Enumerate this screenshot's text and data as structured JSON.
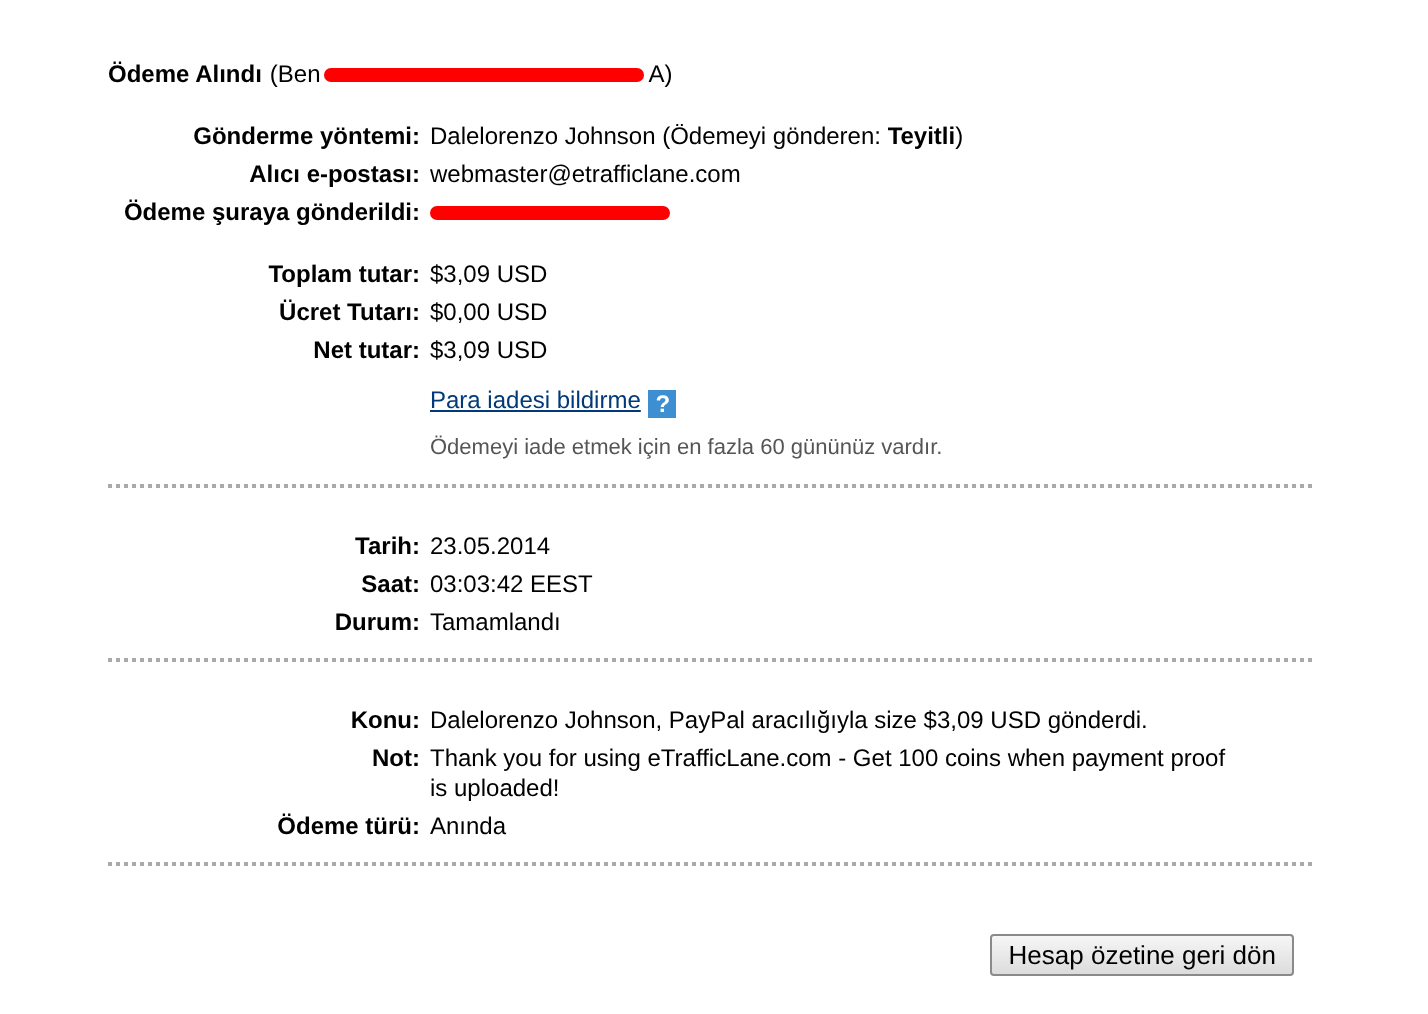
{
  "header": {
    "title": "Ödeme Alındı",
    "parts": [
      {
        "kind": "text",
        "value": "(Ben"
      },
      {
        "kind": "redacted"
      },
      {
        "kind": "text",
        "value": "A)"
      }
    ]
  },
  "sections": [
    {
      "groups": [
        [
          {
            "kind": "text",
            "label": "Gönderme yöntemi:",
            "value": "Dalelorenzo Johnson (Ödemeyi gönderen: **Teyitli**)"
          },
          {
            "kind": "text",
            "label": "Alıcı e-postası:",
            "value": "webmaster@etrafficlane.com"
          },
          {
            "kind": "redacted",
            "label": "Ödeme şuraya gönderildi:"
          }
        ],
        [
          {
            "kind": "text",
            "label": "Toplam tutar:",
            "value": "$3,09 USD"
          },
          {
            "kind": "text",
            "label": "Ücret Tutarı:",
            "value": "$0,00 USD"
          },
          {
            "kind": "text",
            "label": "Net tutar:",
            "value": "$3,09 USD"
          },
          {
            "kind": "link",
            "value": "Para iadesi bildirme",
            "help": "?"
          },
          {
            "kind": "note",
            "value": "Ödemeyi iade etmek için en fazla 60 gününüz vardır."
          }
        ]
      ]
    },
    {
      "groups": [
        [
          {
            "kind": "text",
            "label": "Tarih:",
            "value": "23.05.2014"
          },
          {
            "kind": "text",
            "label": "Saat:",
            "value": "03:03:42 EEST"
          },
          {
            "kind": "text",
            "label": "Durum:",
            "value": "Tamamlandı"
          }
        ]
      ]
    },
    {
      "groups": [
        [
          {
            "kind": "text",
            "label": "Konu:",
            "value": "Dalelorenzo Johnson, PayPal aracılığıyla size $3,09 USD gönderdi."
          },
          {
            "kind": "text",
            "label": "Not:",
            "value": "Thank you for using eTrafficLane.com - Get 100 coins when payment proof is uploaded!"
          },
          {
            "kind": "text",
            "label": "Ödeme türü:",
            "value": "Anında"
          }
        ]
      ]
    }
  ],
  "button": "Hesap özetine geri dön"
}
